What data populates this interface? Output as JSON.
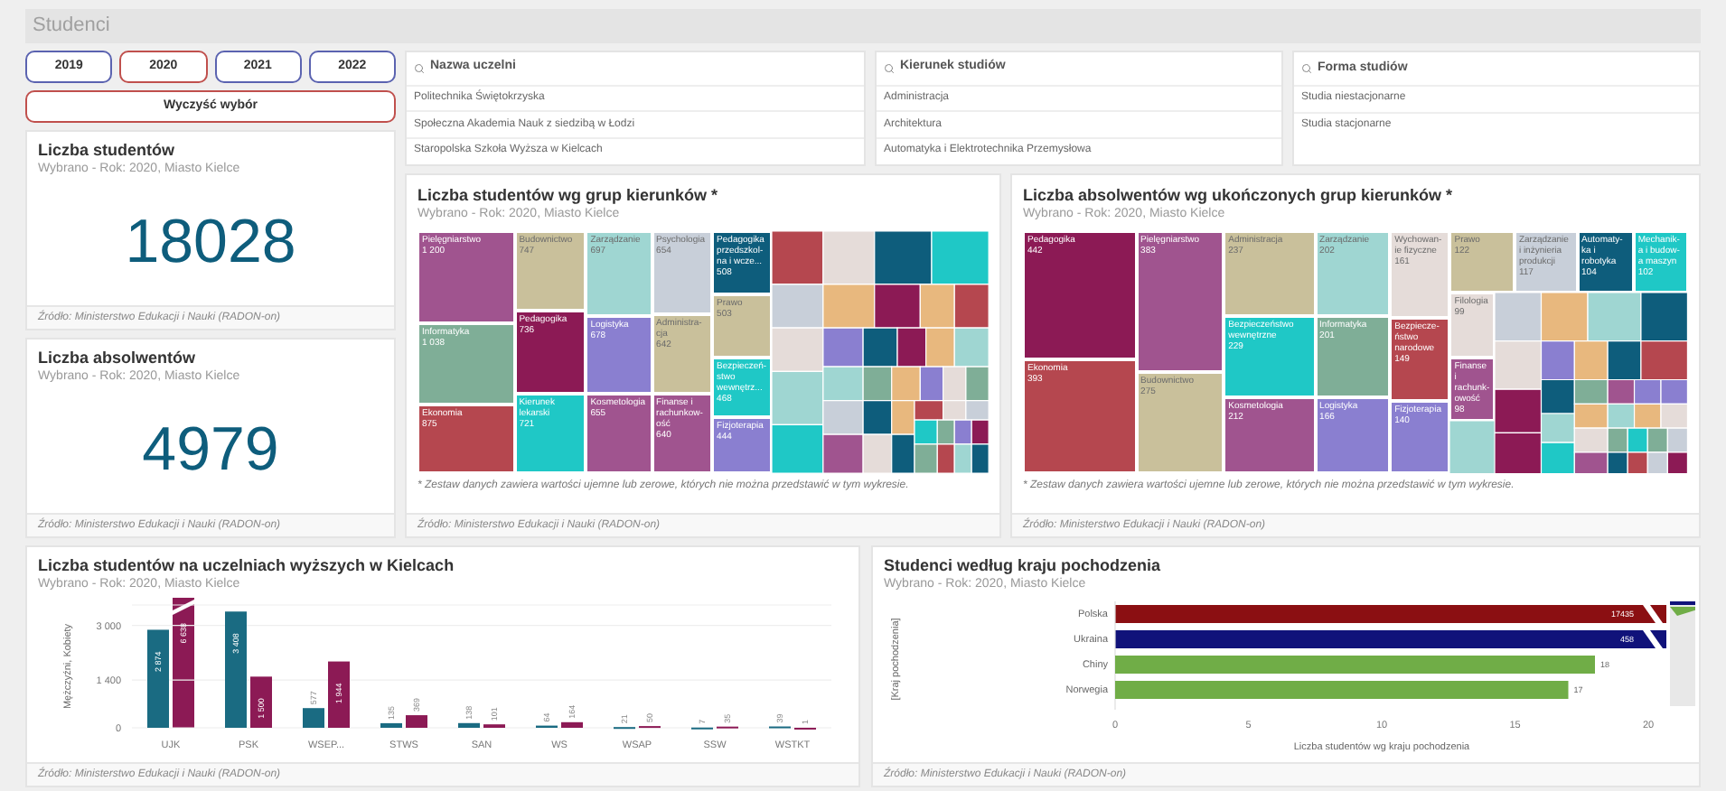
{
  "header": {
    "title": "Studenci"
  },
  "year_buttons": [
    {
      "label": "2019",
      "selected": false
    },
    {
      "label": "2020",
      "selected": true
    },
    {
      "label": "2021",
      "selected": false
    },
    {
      "label": "2022",
      "selected": false
    }
  ],
  "clear_button": {
    "label": "Wyczyść wybór"
  },
  "filters": [
    {
      "title": "Nazwa uczelni",
      "items": [
        "Politechnika Świętokrzyska",
        "Społeczna Akademia Nauk z siedzibą w Łodzi",
        "Staropolska Szkoła Wyższa w Kielcach"
      ]
    },
    {
      "title": "Kierunek studiów",
      "items": [
        "Administracja",
        "Architektura",
        "Automatyka i Elektrotechnika Przemysłowa"
      ]
    },
    {
      "title": "Forma studiów",
      "items": [
        "Studia niestacjonarne",
        "Studia stacjonarne"
      ]
    }
  ],
  "kpis": [
    {
      "title": "Liczba studentów",
      "subtitle": "Wybrano - Rok: 2020, Miasto Kielce",
      "value": "18028",
      "source": "Źródło: Ministerstwo Edukacji i Nauki (RADON-on)"
    },
    {
      "title": "Liczba absolwentów",
      "subtitle": "Wybrano - Rok: 2020, Miasto Kielce",
      "value": "4979",
      "source": "Źródło: Ministerstwo Edukacji i Nauki (RADON-on)"
    }
  ],
  "treemaps": [
    {
      "title": "Liczba studentów wg grup kierunków *",
      "subtitle": "Wybrano - Rok: 2020, Miasto Kielce",
      "note": "* Zestaw danych zawiera wartości ujemne lub zerowe, których nie można przedstawić w tym wykresie.",
      "source": "Źródło: Ministerstwo Edukacji i Nauki (RADON-on)",
      "tiles": [
        {
          "label": "Pielęgniarstwo",
          "value": "1 200",
          "color": "#a0548f"
        },
        {
          "label": "Informatyka",
          "value": "1 038",
          "color": "#7fae97"
        },
        {
          "label": "Ekonomia",
          "value": "875",
          "color": "#b5474f"
        },
        {
          "label": "Budownictwo",
          "value": "747",
          "color": "#c9c09b"
        },
        {
          "label": "Pedagogika",
          "value": "736",
          "color": "#8c1a55"
        },
        {
          "label": "Kierunek lekarski",
          "value": "721",
          "color": "#1fc8c6"
        },
        {
          "label": "Zarządzanie",
          "value": "697",
          "color": "#9fd6d2"
        },
        {
          "label": "Logistyka",
          "value": "678",
          "color": "#8a7fd0"
        },
        {
          "label": "Kosmetologia",
          "value": "655",
          "color": "#a0548f"
        },
        {
          "label": "Psychologia",
          "value": "654",
          "color": "#c8cfd9"
        },
        {
          "label": "Administra-cja",
          "value": "642",
          "color": "#c9c09b"
        },
        {
          "label": "Finanse i rachunkow-ość",
          "value": "640",
          "color": "#a0548f"
        },
        {
          "label": "Pedagogika przedszkol-na i wcze...",
          "value": "508",
          "color": "#0e5d7c"
        },
        {
          "label": "Prawo",
          "value": "503",
          "color": "#c9c09b"
        },
        {
          "label": "Bezpieczeń-stwo wewnętrz...",
          "value": "468",
          "color": "#1fc8c6"
        },
        {
          "label": "Fizjoterapia",
          "value": "444",
          "color": "#8a7fd0"
        }
      ]
    },
    {
      "title": "Liczba absolwentów wg ukończonych grup kierunków *",
      "subtitle": "Wybrano - Rok: 2020, Miasto Kielce",
      "note": "* Zestaw danych zawiera wartości ujemne lub zerowe, których nie można przedstawić w tym wykresie.",
      "source": "Źródło: Ministerstwo Edukacji i Nauki (RADON-on)",
      "tiles": [
        {
          "label": "Pedagogika",
          "value": "442",
          "color": "#8c1a55"
        },
        {
          "label": "Ekonomia",
          "value": "393",
          "color": "#b5474f"
        },
        {
          "label": "Pielęgniarstwo",
          "value": "383",
          "color": "#a0548f"
        },
        {
          "label": "Budownictwo",
          "value": "275",
          "color": "#c9c09b"
        },
        {
          "label": "Administracja",
          "value": "237",
          "color": "#c9c09b"
        },
        {
          "label": "Bezpieczeństwo wewnętrzne",
          "value": "229",
          "color": "#1fc8c6"
        },
        {
          "label": "Kosmetologia",
          "value": "212",
          "color": "#a0548f"
        },
        {
          "label": "Zarządzanie",
          "value": "202",
          "color": "#9fd6d2"
        },
        {
          "label": "Informatyka",
          "value": "201",
          "color": "#7fae97"
        },
        {
          "label": "Logistyka",
          "value": "166",
          "color": "#8a7fd0"
        },
        {
          "label": "Wychowan-ie fizyczne",
          "value": "161",
          "color": "#e5dcd9"
        },
        {
          "label": "Bezpiecze-ństwo narodowe",
          "value": "149",
          "color": "#b5474f"
        },
        {
          "label": "Fizjoterapia",
          "value": "140",
          "color": "#8a7fd0"
        },
        {
          "label": "Prawo",
          "value": "122",
          "color": "#c9c09b"
        },
        {
          "label": "Filologia",
          "value": "99",
          "color": "#e5dcd9"
        },
        {
          "label": "Finanse i rachunk-owość",
          "value": "98",
          "color": "#a0548f"
        },
        {
          "label": "Zarządzanie i inżynieria produkcji",
          "value": "117",
          "color": "#c8cfd9"
        },
        {
          "label": "Automaty-ka i robotyka",
          "value": "104",
          "color": "#0e5d7c"
        },
        {
          "label": "Mechanik-a i budow-a maszyn",
          "value": "102",
          "color": "#1fc8c6"
        }
      ]
    }
  ],
  "universities_panel": {
    "title": "Liczba studentów na uczelniach wyższych w Kielcach",
    "subtitle": "Wybrano - Rok: 2020, Miasto Kielce",
    "source": "Źródło: Ministerstwo Edukacji i Nauki (RADON-on)",
    "chart_data": {
      "type": "bar",
      "ylabel": "Mężczyźni, Kobiety",
      "categories": [
        "UJK",
        "PSK",
        "WSEP...",
        "STWS",
        "SAN",
        "WS",
        "WSAP",
        "SSW",
        "WSTKT"
      ],
      "ylim": [
        0,
        3600
      ],
      "yticks": [
        {
          "value": 0,
          "label": "0"
        },
        {
          "value": 1400,
          "label": "1 400"
        },
        {
          "value": 3000,
          "label": "3 000"
        }
      ],
      "series": [
        {
          "color": "#1a6b82",
          "values": [
            2874,
            3408,
            577,
            135,
            138,
            64,
            21,
            7,
            39
          ],
          "value_labels": [
            "2 874",
            "3 408",
            "577",
            "135",
            "138",
            "64",
            "21",
            "7",
            "39"
          ]
        },
        {
          "color": "#8c1a55",
          "values": [
            null,
            1500,
            1944,
            369,
            101,
            164,
            50,
            35,
            1
          ],
          "value_labels": [
            "6 638",
            "1 500",
            "1 944",
            "369",
            "101",
            "164",
            "50",
            "35",
            "1"
          ]
        }
      ]
    }
  },
  "countries_panel": {
    "title": "Studenci według kraju pochodzenia",
    "subtitle": "Wybrano - Rok: 2020, Miasto Kielce",
    "source": "Źródło: Ministerstwo Edukacji i Nauki (RADON-on)",
    "chart_data": {
      "type": "bar",
      "orientation": "horizontal",
      "xlabel": "Liczba studentów wg kraju pochodzenia",
      "ylabel": "[Kraj pochodzenia]",
      "categories": [
        "Polska",
        "Ukraina",
        "Chiny",
        "Norwegia"
      ],
      "xlim": [
        0,
        20
      ],
      "xticks": [
        0,
        5,
        10,
        15,
        20
      ],
      "series": [
        {
          "values": [
            null,
            null,
            18,
            17
          ],
          "colors": [
            "#8b0f12",
            "#10127a",
            "#70ad47",
            "#70ad47"
          ],
          "value_labels": [
            "17435",
            "458",
            "18",
            "17"
          ]
        }
      ]
    }
  }
}
